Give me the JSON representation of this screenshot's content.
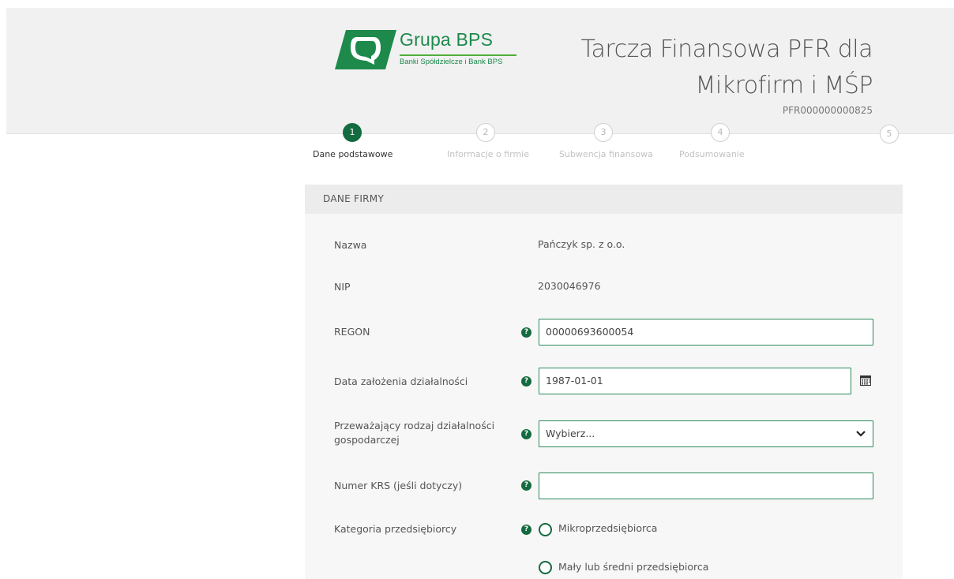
{
  "header": {
    "logo_name": "Grupa BPS",
    "logo_subtitle": "Banki Spółdzielcze i Bank BPS",
    "title_line1": "Tarcza Finansowa PFR dla",
    "title_line2": "Mikrofirm i MŚP",
    "reference": "PFR000000000825",
    "brand_color": "#146b3f"
  },
  "steps": [
    {
      "number": "1",
      "label": "Dane podstawowe",
      "active": true
    },
    {
      "number": "2",
      "label": "Informacje o firmie",
      "active": false
    },
    {
      "number": "3",
      "label": "Subwencja finansowa",
      "active": false
    },
    {
      "number": "4",
      "label": "Podsumowanie",
      "active": false
    },
    {
      "number": "5",
      "label": "",
      "active": false
    }
  ],
  "section": {
    "title": "DANE FIRMY"
  },
  "form": {
    "name_label": "Nazwa",
    "name_value": "Pańczyk sp. z o.o.",
    "nip_label": "NIP",
    "nip_value": "2030046976",
    "regon_label": "REGON",
    "regon_value": "00000693600054",
    "date_label": "Data założenia działalności",
    "date_value": "1987-01-01",
    "activity_label_line1": "Przeważający rodzaj działalności",
    "activity_label_line2": "gospodarczej",
    "activity_selected": "Wybierz...",
    "krs_label": "Numer KRS (jeśli dotyczy)",
    "krs_value": "",
    "category_label": "Kategoria przedsiębiorcy",
    "category_options": [
      "Mikroprzedsiębiorca",
      "Mały lub średni przedsiębiorca"
    ],
    "help_glyph": "?"
  },
  "icons": {
    "help": "question-circle-icon",
    "calendar": "calendar-icon",
    "dropdown": "chevron-down-icon",
    "logo": "grupa-bps-logo"
  }
}
